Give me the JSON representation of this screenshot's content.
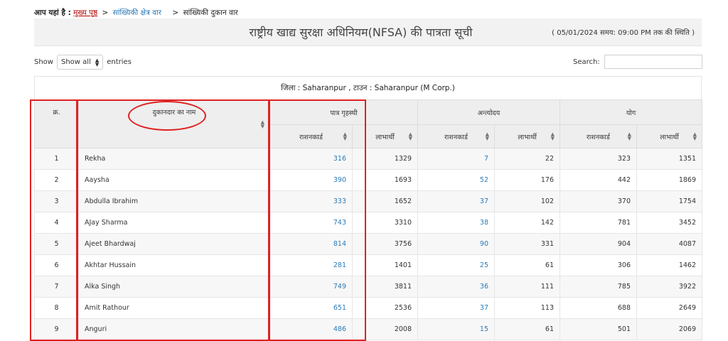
{
  "breadcrumb": {
    "label": "आप यहां है :",
    "home": "मुख्य पृष्ठ",
    "sep1": ">",
    "item1": "सांख्यिकी क्षेत्र वार",
    "sep2": ">",
    "current": "सांख्यिकी दुकान वार"
  },
  "header": {
    "title": "राष्ट्रीय खाद्य सुरक्षा अधिनियम(NFSA) की पात्रता सूची",
    "status": "( 05/01/2024 समय: 09:00 PM तक की स्थिति )"
  },
  "controls": {
    "show_label": "Show",
    "show_value": "Show all",
    "entries_label": "entries",
    "search_label": "Search:"
  },
  "district_line": "जिला : Saharanpur , टाउन : Saharanpur (M Corp.)",
  "table": {
    "col_sno": "क्र.",
    "col_name": "दुकानदार का नाम",
    "group_patra": "पात्र गृहस्थी",
    "group_antyodaya": "अन्त्योदय",
    "group_yog": "योग",
    "sub_ration": "राशनकार्ड",
    "sub_labharthi": "लाभार्थी",
    "rows": [
      {
        "sno": "1",
        "name": "Rekha",
        "p_rc": "316",
        "p_lb": "1329",
        "a_rc": "7",
        "a_lb": "22",
        "y_rc": "323",
        "y_lb": "1351"
      },
      {
        "sno": "2",
        "name": "Aaysha",
        "p_rc": "390",
        "p_lb": "1693",
        "a_rc": "52",
        "a_lb": "176",
        "y_rc": "442",
        "y_lb": "1869"
      },
      {
        "sno": "3",
        "name": "Abdulla Ibrahim",
        "p_rc": "333",
        "p_lb": "1652",
        "a_rc": "37",
        "a_lb": "102",
        "y_rc": "370",
        "y_lb": "1754"
      },
      {
        "sno": "4",
        "name": "AJay Sharma",
        "p_rc": "743",
        "p_lb": "3310",
        "a_rc": "38",
        "a_lb": "142",
        "y_rc": "781",
        "y_lb": "3452"
      },
      {
        "sno": "5",
        "name": "Ajeet Bhardwaj",
        "p_rc": "814",
        "p_lb": "3756",
        "a_rc": "90",
        "a_lb": "331",
        "y_rc": "904",
        "y_lb": "4087"
      },
      {
        "sno": "6",
        "name": "Akhtar Hussain",
        "p_rc": "281",
        "p_lb": "1401",
        "a_rc": "25",
        "a_lb": "61",
        "y_rc": "306",
        "y_lb": "1462"
      },
      {
        "sno": "7",
        "name": "Alka Singh",
        "p_rc": "749",
        "p_lb": "3811",
        "a_rc": "36",
        "a_lb": "111",
        "y_rc": "785",
        "y_lb": "3922"
      },
      {
        "sno": "8",
        "name": "Amit Rathour",
        "p_rc": "651",
        "p_lb": "2536",
        "a_rc": "37",
        "a_lb": "113",
        "y_rc": "688",
        "y_lb": "2649"
      },
      {
        "sno": "9",
        "name": "Anguri",
        "p_rc": "486",
        "p_lb": "2008",
        "a_rc": "15",
        "a_lb": "61",
        "y_rc": "501",
        "y_lb": "2069"
      }
    ]
  },
  "colors": {
    "link": "#2a7ab8",
    "annotation": "#e02020",
    "header_bg": "#eeeeee",
    "home_link": "#b30000"
  }
}
